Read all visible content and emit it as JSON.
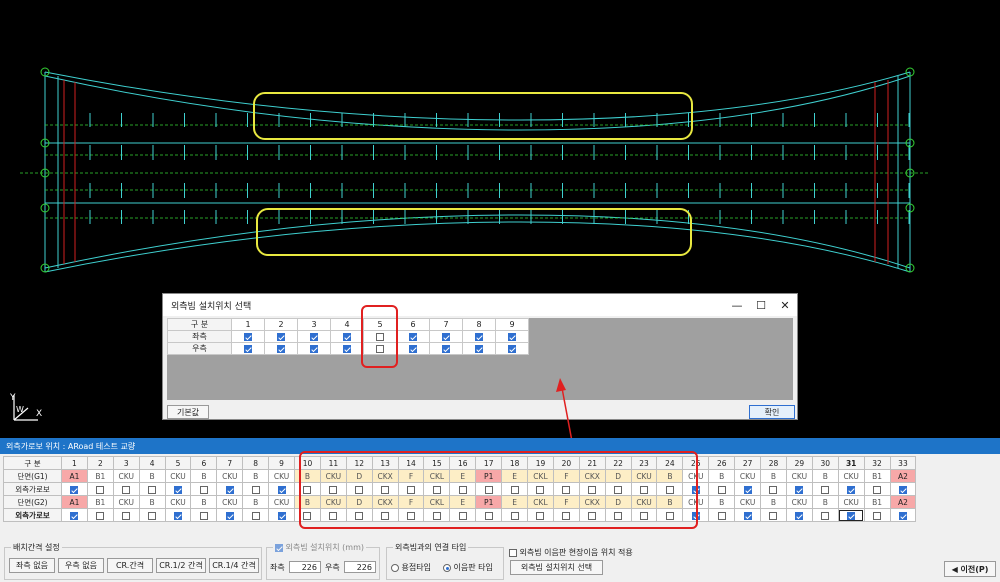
{
  "dialog": {
    "title": "외측빔 설치위치 선택",
    "header_label": "구 분",
    "columns": [
      "1",
      "2",
      "3",
      "4",
      "5",
      "6",
      "7",
      "8",
      "9"
    ],
    "rows": [
      {
        "label": "좌측",
        "checked": [
          true,
          true,
          true,
          true,
          false,
          true,
          true,
          true,
          true
        ]
      },
      {
        "label": "우측",
        "checked": [
          true,
          true,
          true,
          true,
          false,
          true,
          true,
          true,
          true
        ]
      }
    ],
    "default_button": "기본값",
    "ok_button": "확인",
    "minimize": "—",
    "maximize": "☐",
    "close": "✕"
  },
  "panel": {
    "title": "외측가로보 위치 : ARoad 테스트 교량",
    "header_label": "구 분",
    "columns": [
      "1",
      "2",
      "3",
      "4",
      "5",
      "6",
      "7",
      "8",
      "9",
      "10",
      "11",
      "12",
      "13",
      "14",
      "15",
      "16",
      "17",
      "18",
      "19",
      "20",
      "21",
      "22",
      "23",
      "24",
      "25",
      "26",
      "27",
      "28",
      "29",
      "30",
      "31",
      "32",
      "33"
    ],
    "rows": [
      {
        "label": "단면(G1)",
        "cells": [
          "A1",
          "B1",
          "CKU",
          "B",
          "CKU",
          "B",
          "CKU",
          "B",
          "CKU",
          "B",
          "CKU",
          "D",
          "CKX",
          "F",
          "CKL",
          "E",
          "P1",
          "E",
          "CKL",
          "F",
          "CKX",
          "D",
          "CKU",
          "B",
          "CKU",
          "B",
          "CKU",
          "B",
          "CKU",
          "B",
          "CKU",
          "B1",
          "A2"
        ]
      },
      {
        "label": "외측가로보",
        "checks": [
          true,
          false,
          false,
          false,
          true,
          false,
          true,
          false,
          true,
          false,
          false,
          false,
          false,
          false,
          false,
          false,
          false,
          false,
          false,
          false,
          false,
          false,
          false,
          false,
          true,
          false,
          true,
          false,
          true,
          false,
          true,
          false,
          true
        ]
      },
      {
        "label": "단면(G2)",
        "cells": [
          "A1",
          "B1",
          "CKU",
          "B",
          "CKU",
          "B",
          "CKU",
          "B",
          "CKU",
          "B",
          "CKU",
          "D",
          "CKX",
          "F",
          "CKL",
          "E",
          "P1",
          "E",
          "CKL",
          "F",
          "CKX",
          "D",
          "CKU",
          "B",
          "CKU",
          "B",
          "CKU",
          "B",
          "CKU",
          "B",
          "CKU",
          "B1",
          "A2"
        ]
      },
      {
        "label": "외측가로보",
        "checks": [
          true,
          false,
          false,
          false,
          true,
          false,
          true,
          false,
          true,
          false,
          false,
          false,
          false,
          false,
          false,
          false,
          false,
          false,
          false,
          false,
          false,
          false,
          false,
          false,
          true,
          false,
          true,
          false,
          true,
          false,
          true,
          false,
          true
        ]
      }
    ],
    "bold_column": "31",
    "spacing_group": {
      "legend": "배치간격 설정",
      "buttons": [
        "좌측 없음",
        "우측 없음",
        "CR.간격",
        "CR.1/2 간격",
        "CR.1/4 간격"
      ]
    },
    "position_group": {
      "legend": "외측빔 설치위치 (mm)",
      "left_label": "좌측",
      "left_value": "226",
      "right_label": "우측",
      "right_value": "226"
    },
    "connection_group": {
      "legend": "외측빔과의 연결 타입",
      "options": [
        "용접타입",
        "이음판 타입"
      ],
      "selected": 1
    },
    "site_apply": "외측빔 이음판 현장이음 위치 적용",
    "select_button": "외측빔 설치위치 선택",
    "prev_button": "◀ 이전(P)"
  },
  "axis_labels": {
    "x": "X",
    "y": "Y",
    "z": "W"
  },
  "colors": {
    "accent": "#1e74c8",
    "highlight_red": "#e02020",
    "highlight_yellow": "#e8e840",
    "cad_line": "#3fd0d0",
    "cad_green": "#35d335"
  }
}
